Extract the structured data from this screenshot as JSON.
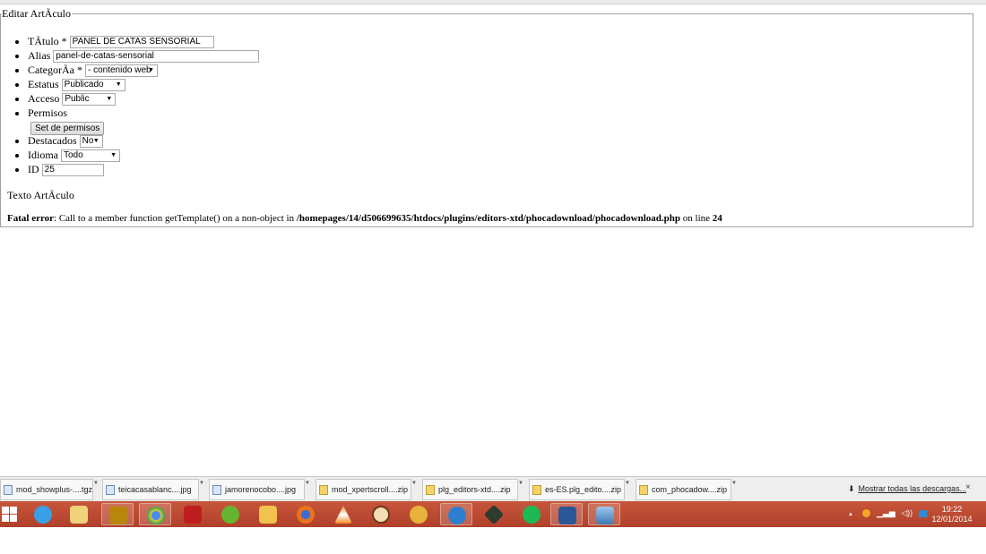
{
  "form": {
    "legend": "Editar ArtÃculo",
    "fields": {
      "titulo": {
        "label": "TÃtulo *",
        "value": "PANEL DE CATAS SENSORIAL"
      },
      "alias": {
        "label": "Alias",
        "value": "panel-de-catas-sensorial"
      },
      "categoria": {
        "label": "CategorÃa *",
        "value": "- contenido web"
      },
      "estatus": {
        "label": "Estatus",
        "value": "Publicado"
      },
      "acceso": {
        "label": "Acceso",
        "value": "Public"
      },
      "permisos": {
        "label": "Permisos",
        "button": "Set de permisos"
      },
      "destacados": {
        "label": "Destacados",
        "value": "No"
      },
      "idioma": {
        "label": "Idioma",
        "value": "Todo"
      },
      "id": {
        "label": "ID",
        "value": "25"
      }
    },
    "texto_label": "Texto ArtÃculo",
    "error": {
      "prefix": "Fatal error",
      "message": ": Call to a member function getTemplate() on a non-object in ",
      "path": "/homepages/14/d506699635/htdocs/plugins/editors-xtd/phocadownload/phocadownload.php",
      "on_line": " on line ",
      "line": "24"
    }
  },
  "downloads": {
    "items": [
      {
        "name": "mod_showplus-....tgz",
        "icon": "file-icon"
      },
      {
        "name": "teicacasablanc....jpg",
        "icon": "image-icon"
      },
      {
        "name": "jamorenocobo....jpg",
        "icon": "image-icon"
      },
      {
        "name": "mod_xpertscroll....zip",
        "icon": "zip-icon"
      },
      {
        "name": "plg_editors-xtd....zip",
        "icon": "zip-icon"
      },
      {
        "name": "es-ES.plg_edito....zip",
        "icon": "zip-icon"
      },
      {
        "name": "com_phocadow....zip",
        "icon": "zip-icon"
      }
    ],
    "show_all": "Mostrar todas las descargas...",
    "close": "×"
  },
  "taskbar": {
    "apps": [
      "windows-start",
      "internet-explorer",
      "file-explorer",
      "fireworks",
      "chrome",
      "filezilla",
      "utorrent",
      "envelope-app",
      "firefox",
      "vlc",
      "hand-app",
      "paint-app",
      "globe-app",
      "terminal-app",
      "spotify",
      "word",
      "screen-app"
    ],
    "clock_time": "19:22",
    "clock_date": "12/01/2014",
    "tray_arrow": "▲",
    "colors": {
      "taskbar": "#b8462f"
    }
  }
}
